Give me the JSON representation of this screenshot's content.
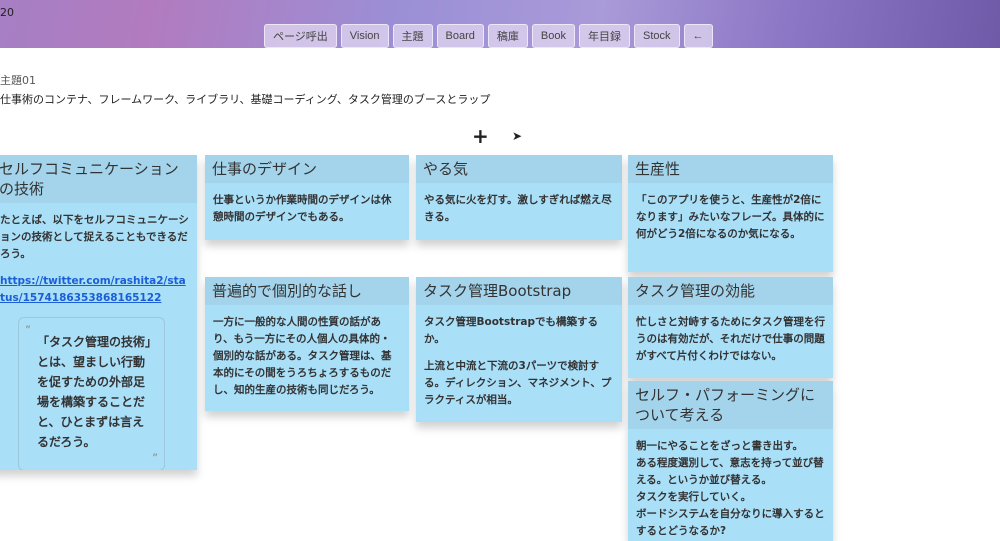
{
  "header": {
    "corner_text": "20",
    "nav": [
      "ページ呼出",
      "Vision",
      "主題",
      "Board",
      "稿庫",
      "Book",
      "年目録",
      "Stock",
      "←"
    ]
  },
  "page": {
    "meta": "主題01",
    "description": "仕事術のコンテナ、フレームワーク、ライブラリ、基礎コーディング、タスク管理のブースとラップ",
    "add_label": "+"
  },
  "cards": [
    {
      "title": "セルフコミュニケーションの技術",
      "body": "たとえば、以下をセルフコミュニケーションの技術として捉えることもできるだろう。",
      "link": "https://twitter.com/rashita2/status/1574186353868165122",
      "quote": "「タスク管理の技術」とは、望ましい行動を促すための外部足場を構築することだと、ひとまずは言えるだろう。",
      "quote_open": "”",
      "quote_close": "”"
    },
    {
      "title": "仕事のデザイン",
      "body": "仕事というか作業時間のデザインは休憩時間のデザインでもある。"
    },
    {
      "title": "普遍的で個別的な話し",
      "body": "一方に一般的な人間の性質の話があり、もう一方にその人個人の具体的・個別的な話がある。タスク管理は、基本的にその間をうろちょろするものだし、知的生産の技術も同じだろう。"
    },
    {
      "title": "やる気",
      "body": "やる気に火を灯す。激しすぎれば燃え尽きる。"
    },
    {
      "title": "タスク管理Bootstrap",
      "body": "タスク管理Bootstrapでも構築するか。",
      "body2": "上流と中流と下流の3パーツで検討する。ディレクション、マネジメント、プラクティスが相当。"
    },
    {
      "title": "生産性",
      "body": "「このアプリを使うと、生産性が2倍になります」みたいなフレーズ。具体的に何がどう2倍になるのか気になる。"
    },
    {
      "title": "タスク管理の効能",
      "body": "忙しさと対峙するためにタスク管理を行うのは有効だが、それだけで仕事の問題がすべて片付くわけではない。"
    },
    {
      "title": "セルフ・パフォーミングについて考える",
      "lines": [
        "朝一にやることをざっと書き出す。",
        "ある程度選別して、意志を持って並び替える。というか並び替える。",
        "タスクを実行していく。",
        "ボードシステムを自分なりに導入するとするとどうなるか?"
      ]
    }
  ]
}
